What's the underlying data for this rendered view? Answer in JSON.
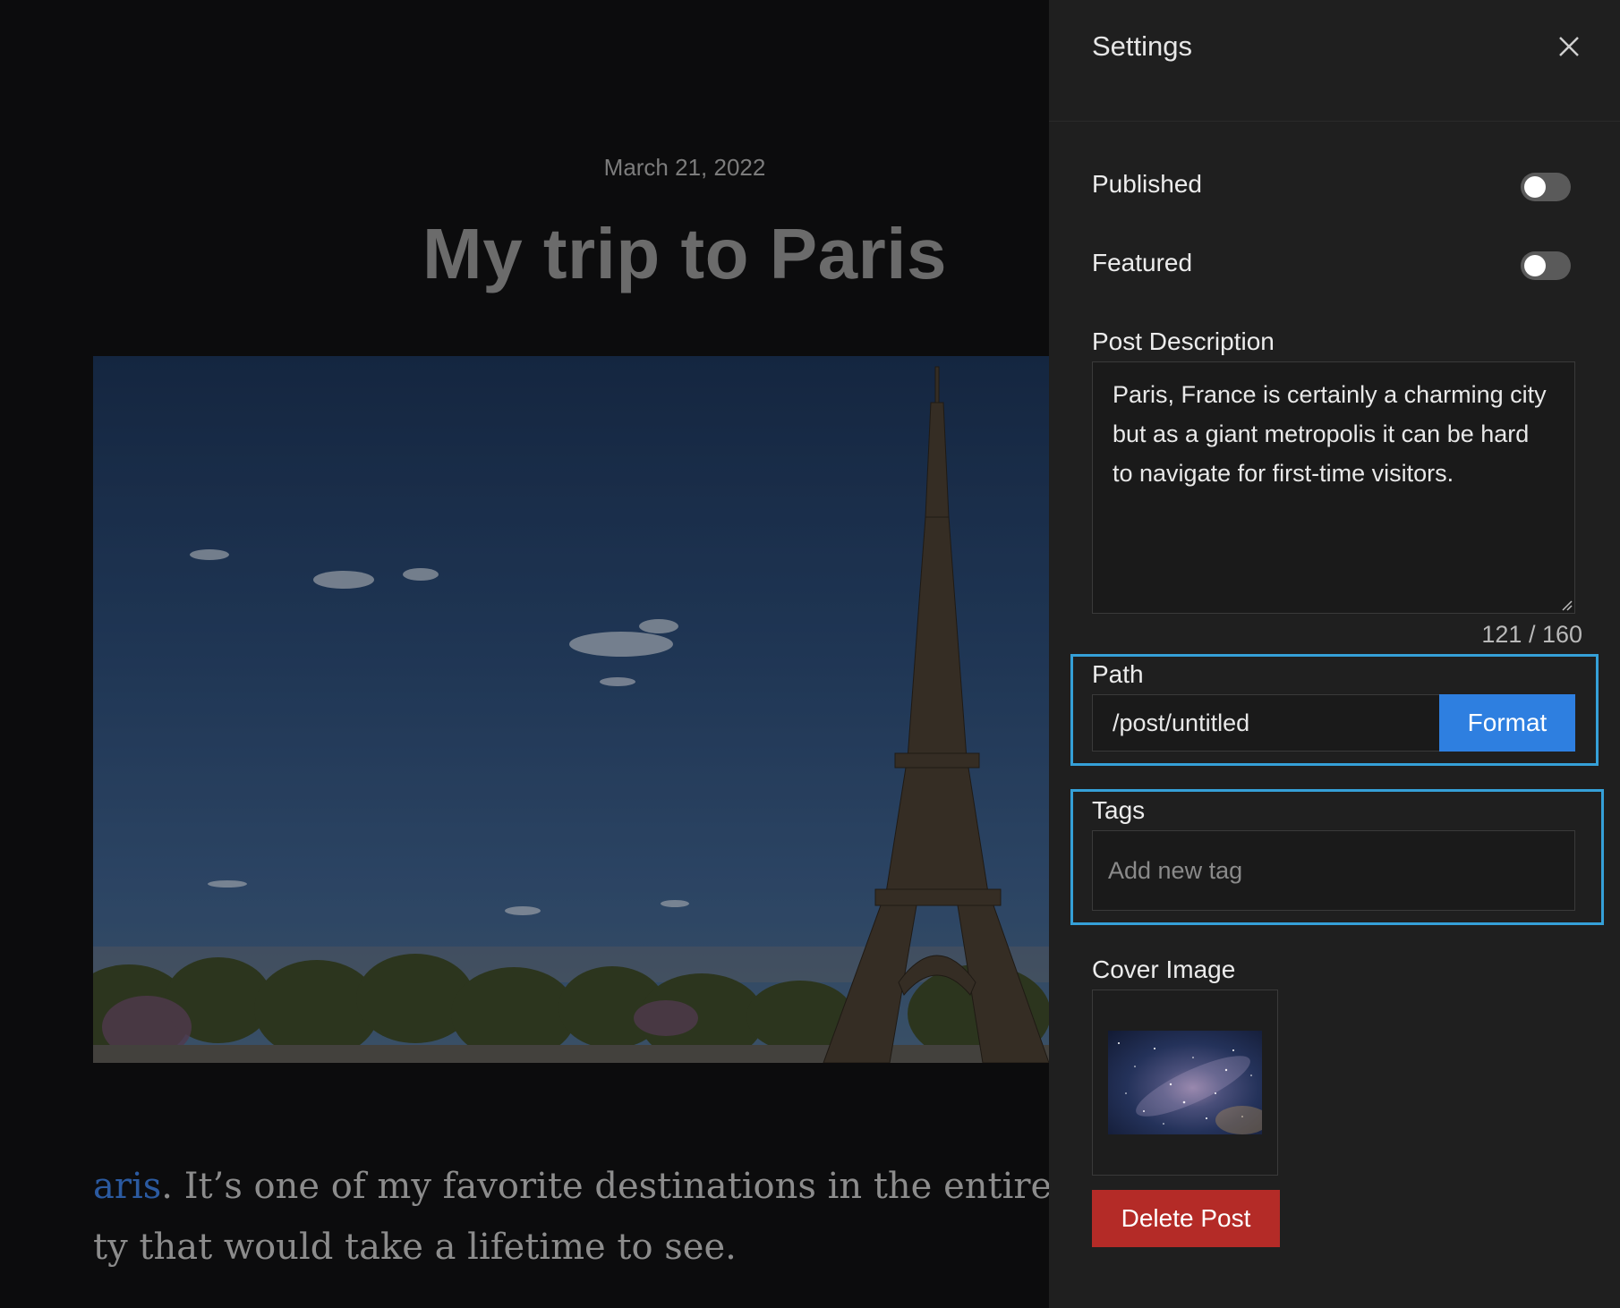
{
  "article": {
    "date": "March 21, 2022",
    "title": "My trip to Paris",
    "body_line1_link": "aris",
    "body_line1_rest": ". It’s one of my favorite destinations in the entire wor",
    "body_line2": "ty that would take a lifetime to see."
  },
  "settings": {
    "title": "Settings",
    "published": {
      "label": "Published",
      "on": false
    },
    "featured": {
      "label": "Featured",
      "on": false
    },
    "description": {
      "label": "Post Description",
      "value": "Paris, France is certainly a charming city but as a giant metropolis it can be hard to navigate for first-time visitors.",
      "count": "121 / 160"
    },
    "path": {
      "label": "Path",
      "value": "/post/untitled",
      "button": "Format"
    },
    "tags": {
      "label": "Tags",
      "placeholder": "Add new tag"
    },
    "cover": {
      "label": "Cover Image"
    },
    "delete_button": "Delete Post"
  },
  "colors": {
    "panel_bg": "#1f1f1f",
    "accent_blue": "#2e7fe0",
    "highlight": "#35a0d8",
    "danger": "#b42b27"
  },
  "icons": {
    "close": "close-icon",
    "resize": "resize-handle-icon"
  }
}
